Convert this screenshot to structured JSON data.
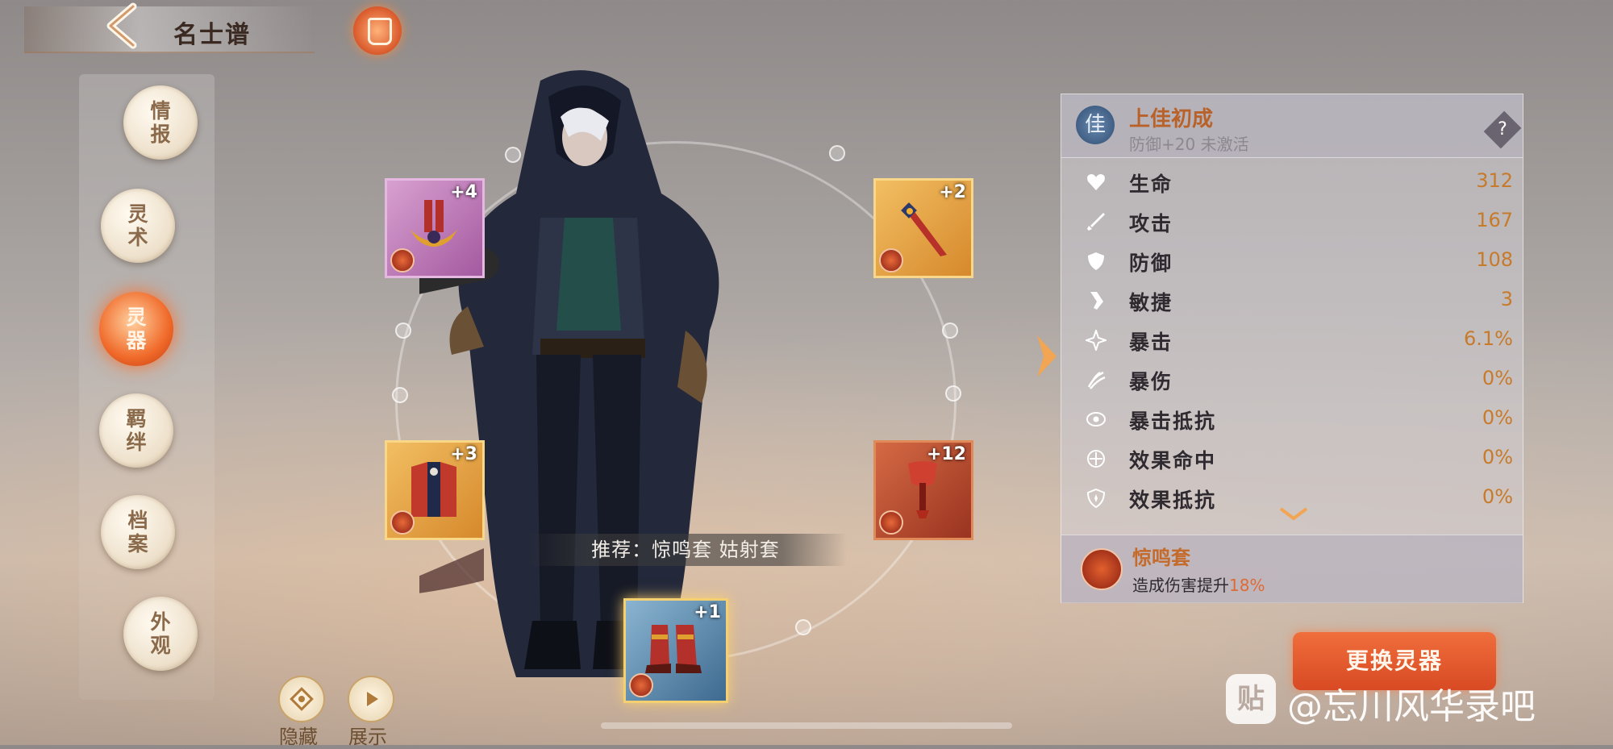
{
  "header": {
    "title": "名士谱"
  },
  "menu": {
    "items": [
      {
        "label": "情报",
        "active": false
      },
      {
        "label": "灵术",
        "active": false
      },
      {
        "label": "灵器",
        "active": true
      },
      {
        "label": "羁绊",
        "active": false
      },
      {
        "label": "档案",
        "active": false
      },
      {
        "label": "外观",
        "active": false
      }
    ]
  },
  "equipment": {
    "slots": [
      {
        "name": "helmet",
        "level": "+4",
        "rarity": "purple"
      },
      {
        "name": "weapon",
        "level": "+2",
        "rarity": "orange"
      },
      {
        "name": "armor",
        "level": "+3",
        "rarity": "orange"
      },
      {
        "name": "accessory",
        "level": "+12",
        "rarity": "red"
      },
      {
        "name": "boots",
        "level": "+1",
        "rarity": "blue",
        "selected": true
      }
    ],
    "recommend": "推荐：惊鸣套 姑射套"
  },
  "bottom_buttons": {
    "hide_label": "隐藏",
    "show_label": "展示"
  },
  "panel": {
    "set_icon_char": "佳",
    "set_name": "上佳初成",
    "set_desc": "防御+20  未激活",
    "help": "?",
    "stats": [
      {
        "name": "生命",
        "value": "312",
        "icon": "heart-icon"
      },
      {
        "name": "攻击",
        "value": "167",
        "icon": "sword-icon"
      },
      {
        "name": "防御",
        "value": "108",
        "icon": "shield-icon"
      },
      {
        "name": "敏捷",
        "value": "3",
        "icon": "boot-icon"
      },
      {
        "name": "暴击",
        "value": "6.1%",
        "icon": "star-burst-icon"
      },
      {
        "name": "暴伤",
        "value": "0%",
        "icon": "claw-icon"
      },
      {
        "name": "暴击抵抗",
        "value": "0%",
        "icon": "eye-icon"
      },
      {
        "name": "效果命中",
        "value": "0%",
        "icon": "target-icon"
      },
      {
        "name": "效果抵抗",
        "value": "0%",
        "icon": "shield-star-icon"
      }
    ],
    "bonus_name": "惊鸣套",
    "bonus_desc_prefix": "造成伤害提升",
    "bonus_desc_value": "18%"
  },
  "actions": {
    "change_equipment": "更换灵器"
  },
  "watermark": {
    "logo": "贴",
    "text": "@忘川风华录吧"
  },
  "colors": {
    "accent": "#e8592c",
    "stat_value": "#c77a2a",
    "set_name": "#b8622a"
  }
}
